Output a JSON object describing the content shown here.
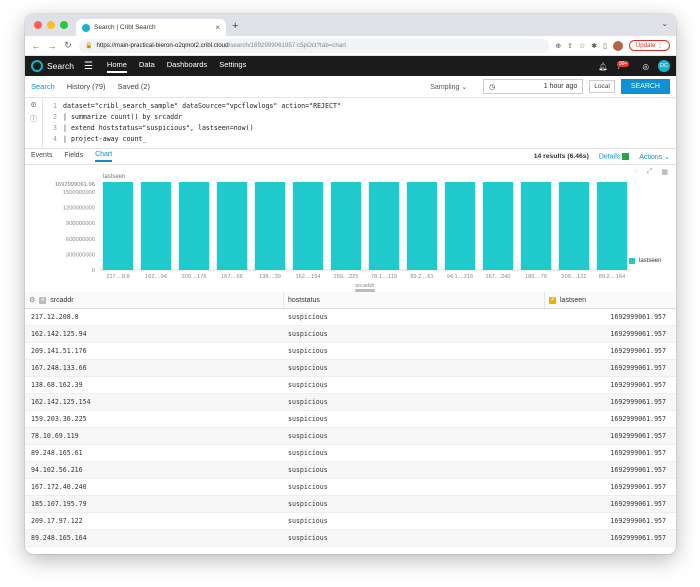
{
  "browser": {
    "tab_title": "Search | Cribl Search",
    "url_host": "https://main-practical-bieron-o2qmot2.cribl.cloud",
    "url_path": "/search/1692999061957.c5pOct?tab=chart",
    "update_label": "Update"
  },
  "app": {
    "name": "Search",
    "nav": [
      "Home",
      "Data",
      "Dashboards",
      "Settings"
    ],
    "notif_count": "99+",
    "user_initials": "DC"
  },
  "searchbar": {
    "tabs": [
      "Search",
      "History (79)",
      "Saved (2)"
    ],
    "sampling": "Sampling",
    "time": "1 hour ago",
    "local": "Local",
    "button": "SEARCH"
  },
  "query_lines": [
    {
      "n": "1",
      "text": "dataset=\"cribl_search_sample\" dataSource=\"vpcflowlogs\" action=\"REJECT\""
    },
    {
      "n": "2",
      "text": "| summarize count() by srcaddr"
    },
    {
      "n": "3",
      "text": "| extend hoststatus=\"suspicious\", lastseen=now()"
    },
    {
      "n": "4",
      "text": "| project-away count_"
    }
  ],
  "results": {
    "tabs": [
      "Events",
      "Fields",
      "Chart"
    ],
    "count": "14 results (6.46s)",
    "details": "Details",
    "actions": "Actions"
  },
  "chart_data": {
    "type": "bar",
    "ylabel": "lastseen",
    "top_label": "1692999061.96",
    "xlabel": "srcaddr",
    "yticks": [
      1500000000,
      1200000000,
      900000000,
      600000000,
      300000000,
      0
    ],
    "ytick_labels": [
      "1500000000",
      "1200000000",
      "900000000",
      "600000000",
      "300000000",
      "0"
    ],
    "ylim": [
      0,
      1692999061.96
    ],
    "categories": [
      "217....8.8",
      "162....94",
      "209....176",
      "167....66",
      "138....39",
      "162....154",
      "159....225",
      "78.1....119",
      "89.2....61",
      "94.1....216",
      "167....240",
      "185....79",
      "209....122",
      "89.2....164"
    ],
    "series": [
      {
        "name": "lastseen",
        "color": "#20c9cc",
        "values": [
          1692999061.957,
          1692999061.957,
          1692999061.957,
          1692999061.957,
          1692999061.957,
          1692999061.957,
          1692999061.957,
          1692999061.957,
          1692999061.957,
          1692999061.957,
          1692999061.957,
          1692999061.957,
          1692999061.957,
          1692999061.957
        ]
      }
    ],
    "legend_position": "right"
  },
  "table": {
    "columns": [
      "srcaddr",
      "hoststatus",
      "lastseen"
    ],
    "rows": [
      [
        "217.12.208.8",
        "suspicious",
        "1692999061.957"
      ],
      [
        "162.142.125.94",
        "suspicious",
        "1692999061.957"
      ],
      [
        "209.141.51.176",
        "suspicious",
        "1692999061.957"
      ],
      [
        "167.248.133.66",
        "suspicious",
        "1692999061.957"
      ],
      [
        "138.68.162.39",
        "suspicious",
        "1692999061.957"
      ],
      [
        "162.142.125.154",
        "suspicious",
        "1692999061.957"
      ],
      [
        "159.203.36.225",
        "suspicious",
        "1692999061.957"
      ],
      [
        "78.10.69.119",
        "suspicious",
        "1692999061.957"
      ],
      [
        "89.248.165.61",
        "suspicious",
        "1692999061.957"
      ],
      [
        "94.102.56.216",
        "suspicious",
        "1692999061.957"
      ],
      [
        "167.172.40.240",
        "suspicious",
        "1692999061.957"
      ],
      [
        "185.107.195.79",
        "suspicious",
        "1692999061.957"
      ],
      [
        "209.17.97.122",
        "suspicious",
        "1692999061.957"
      ],
      [
        "89.248.165.164",
        "suspicious",
        "1692999061.957"
      ]
    ]
  }
}
